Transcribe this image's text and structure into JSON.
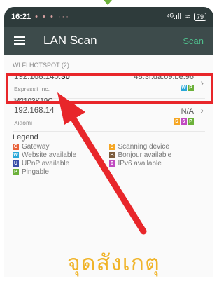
{
  "status": {
    "time": "16:21",
    "dots": "• • • ···",
    "signal": "⁴ᴳ.ıll",
    "battery": "79"
  },
  "appbar": {
    "title": "LAN Scan",
    "scan_label": "Scan"
  },
  "group_title": "WLFI HOTSPOT (2)",
  "devices": [
    {
      "ip_prefix": "192.168.140.",
      "ip_suffix": "30",
      "vendor": "Espressif Inc.",
      "mac": "48:3f:da:69:be:96",
      "badges": [
        "W",
        "P"
      ]
    },
    {
      "name": "M2103K19C",
      "ip": "192.168.14",
      "vendor": "Xiaomi",
      "mac": "N/A",
      "badges": [
        "S",
        "6",
        "P"
      ]
    }
  ],
  "legend": {
    "title": "Legend",
    "items": [
      {
        "letter": "G",
        "label": "Gateway",
        "color": "#e8623a"
      },
      {
        "letter": "S",
        "label": "Scanning device",
        "color": "#f5a623"
      },
      {
        "letter": "W",
        "label": "Website available",
        "color": "#29a8d8"
      },
      {
        "letter": "B",
        "label": "Bonjour available",
        "color": "#7a5a3a"
      },
      {
        "letter": "U",
        "label": "UPnP available",
        "color": "#3a4fa8"
      },
      {
        "letter": "6",
        "label": "IPv6 available",
        "color": "#c04ac0"
      },
      {
        "letter": "P",
        "label": "Pingable",
        "color": "#6cb13a"
      }
    ]
  },
  "badge_colors": {
    "W": "#29a8d8",
    "P": "#6cb13a",
    "S": "#f5a623",
    "6": "#c04ac0"
  },
  "caption": "จุดสังเกตุ",
  "annotation_color": "#e8262a"
}
